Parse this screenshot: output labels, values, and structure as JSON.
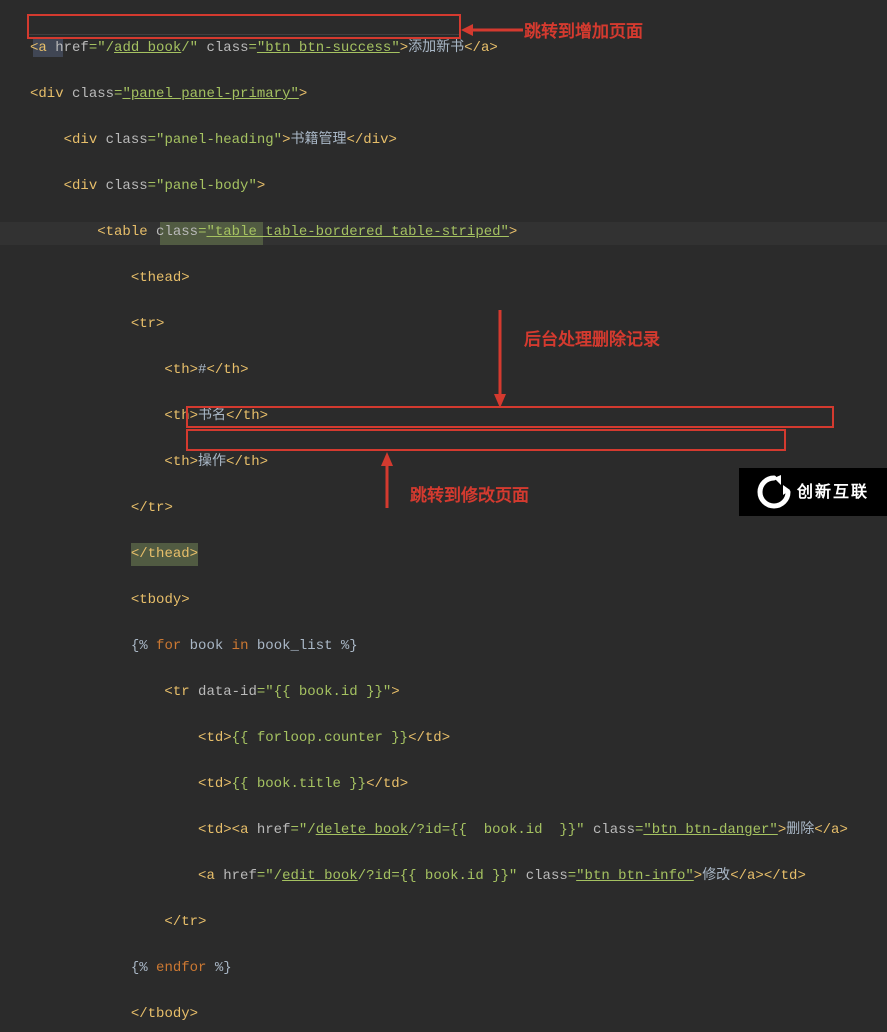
{
  "code": {
    "l1": {
      "a": "<",
      "b": "a ",
      "c": "href",
      "d": "=",
      "e": "\"/",
      "f": "add_book",
      "g": "/\" ",
      "h": "class",
      "i": "=",
      "j": "\"btn btn-success\"",
      "k": ">",
      "l": "添加新书",
      "m": "<",
      "n": "/a",
      "o": ">"
    },
    "l2": {
      "a": "<",
      "b": "div ",
      "c": "class",
      "d": "=",
      "e": "\"panel panel-primary\"",
      "f": ">"
    },
    "l3": {
      "a": "<",
      "b": "div ",
      "c": "class",
      "d": "=",
      "e": "\"panel-heading\"",
      "f": ">",
      "g": "书籍管理",
      "h": "<",
      "i": "/div",
      "j": ">"
    },
    "l4": {
      "a": "<",
      "b": "div ",
      "c": "class",
      "d": "=",
      "e": "\"panel-body\"",
      "f": ">"
    },
    "l5": {
      "a": "<",
      "b": "table ",
      "c": "class",
      "d": "=",
      "e": "\"table table-bordered table-striped\"",
      "f": ">"
    },
    "l6": {
      "a": "<",
      "b": "thead",
      "c": ">"
    },
    "l7": {
      "a": "<",
      "b": "tr",
      "c": ">"
    },
    "l8": {
      "a": "<",
      "b": "th",
      "c": ">",
      "d": "#",
      "e": "<",
      "f": "/th",
      "g": ">"
    },
    "l9": {
      "a": "<",
      "b": "th",
      "c": ">",
      "d": "书名",
      "e": "<",
      "f": "/th",
      "g": ">"
    },
    "l10": {
      "a": "<",
      "b": "th",
      "c": ">",
      "d": "操作",
      "e": "<",
      "f": "/th",
      "g": ">"
    },
    "l11": {
      "a": "<",
      "b": "/tr",
      "c": ">"
    },
    "l12": {
      "a": "<",
      "b": "/thead",
      "c": ">"
    },
    "l13": {
      "a": "<",
      "b": "tbody",
      "c": ">"
    },
    "l14": {
      "a": "{% ",
      "b": "for ",
      "c": "book ",
      "d": "in ",
      "e": "book_list %}"
    },
    "l15": {
      "a": "<",
      "b": "tr ",
      "c": "data-id",
      "d": "=",
      "e": "\"{{ book.id }}\"",
      "f": ">"
    },
    "l16": {
      "a": "<",
      "b": "td",
      "c": ">",
      "d": "{{ forloop.counter }}",
      "e": "<",
      "f": "/td",
      "g": ">"
    },
    "l17": {
      "a": "<",
      "b": "td",
      "c": ">",
      "d": "{{ book.title }}",
      "e": "<",
      "f": "/td",
      "g": ">"
    },
    "l18": {
      "a": "<",
      "b": "td",
      "c": ">",
      "d": "<",
      "e": "a ",
      "f": "href",
      "g": "=",
      "h": "\"/",
      "i": "delete_book",
      "j": "/?id",
      "k": "={{  book.id  }}\" ",
      "l": "class",
      "m": "=",
      "n": "\"btn btn-danger\"",
      "o": ">",
      "p": "删除",
      "q": "<",
      "r": "/a",
      "s": ">"
    },
    "l19": {
      "a": "<",
      "b": "a ",
      "c": "href",
      "d": "=",
      "e": "\"/",
      "f": "edit_book",
      "g": "/?id",
      "h": "={{ book.id }}\" ",
      "i": "class",
      "j": "=",
      "k": "\"btn btn-info\"",
      "l": ">",
      "m": "修改",
      "n": "<",
      "o": "/a",
      "p": ">",
      "q": "<",
      "r": "/td",
      "s": ">"
    },
    "l20": {
      "a": "<",
      "b": "/tr",
      "c": ">"
    },
    "l21": {
      "a": "{% ",
      "b": "endfor ",
      "c": "%}"
    },
    "l22": {
      "a": "<",
      "b": "/tbody",
      "c": ">"
    }
  },
  "annotations": {
    "a1": "跳转到增加页面",
    "a2": "后台处理删除记录",
    "a3": "跳转到修改页面"
  },
  "watermark": {
    "text": "创新互联"
  }
}
